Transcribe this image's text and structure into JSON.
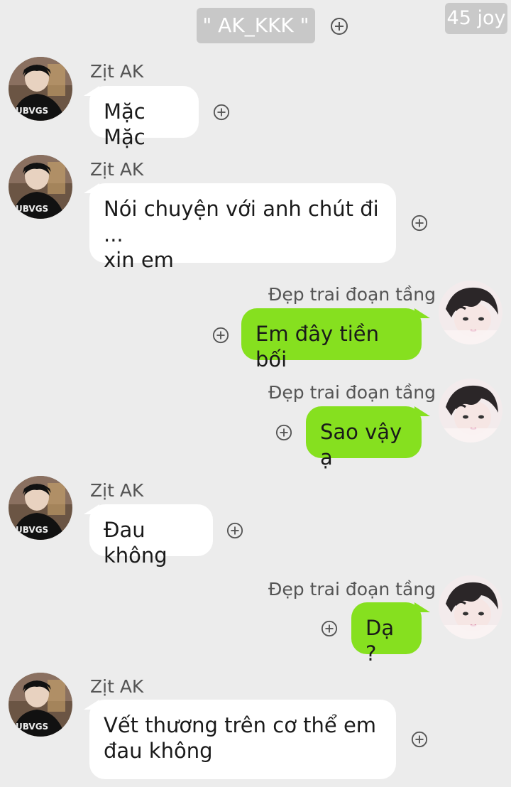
{
  "header": {
    "title": "\" AK_KKK \"",
    "watermark": "45 joy"
  },
  "icons": {
    "add": "plus-circle-icon",
    "avatar_a": "avatar-boy-ubvgs",
    "avatar_b": "avatar-girl-hair"
  },
  "colors": {
    "background": "#ececec",
    "bubble_left": "#ffffff",
    "bubble_right": "#86e01f"
  },
  "messages": [
    {
      "sender": "Zịt AK",
      "side": "left",
      "text": "Mặc Mặc"
    },
    {
      "sender": "Zịt AK",
      "side": "left",
      "text": "Nói chuyện với anh chút đi ...\nxin em"
    },
    {
      "sender": "Đẹp trai đoạn tầng",
      "side": "right",
      "text": "Em đây tiền bối"
    },
    {
      "sender": "Đẹp trai đoạn tầng",
      "side": "right",
      "text": "Sao vậy ạ"
    },
    {
      "sender": "Zịt AK",
      "side": "left",
      "text": "Đau không"
    },
    {
      "sender": "Đẹp trai đoạn tầng",
      "side": "right",
      "text": "Dạ ?"
    },
    {
      "sender": "Zịt AK",
      "side": "left",
      "text": "Vết thương trên cơ thể em\nđau không"
    }
  ]
}
